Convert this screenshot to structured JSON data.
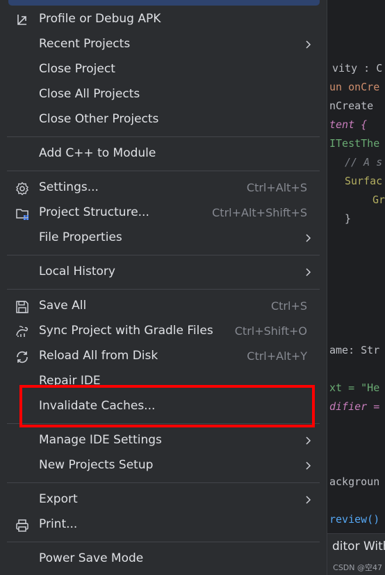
{
  "menu": {
    "items": [
      {
        "label": "Profile or Debug APK",
        "shortcut": "",
        "submenu": false,
        "icon": "profile-debug-icon"
      },
      {
        "label": "Recent Projects",
        "shortcut": "",
        "submenu": true,
        "icon": ""
      },
      {
        "label": "Close Project",
        "shortcut": "",
        "submenu": false,
        "icon": ""
      },
      {
        "label": "Close All Projects",
        "shortcut": "",
        "submenu": false,
        "icon": ""
      },
      {
        "label": "Close Other Projects",
        "shortcut": "",
        "submenu": false,
        "icon": ""
      },
      {
        "label": "Add C++ to Module",
        "shortcut": "",
        "submenu": false,
        "icon": ""
      },
      {
        "label": "Settings...",
        "shortcut": "Ctrl+Alt+S",
        "submenu": false,
        "icon": "gear-icon"
      },
      {
        "label": "Project Structure...",
        "shortcut": "Ctrl+Alt+Shift+S",
        "submenu": false,
        "icon": "project-structure-icon"
      },
      {
        "label": "File Properties",
        "shortcut": "",
        "submenu": true,
        "icon": ""
      },
      {
        "label": "Local History",
        "shortcut": "",
        "submenu": true,
        "icon": ""
      },
      {
        "label": "Save All",
        "shortcut": "Ctrl+S",
        "submenu": false,
        "icon": "save-icon"
      },
      {
        "label": "Sync Project with Gradle Files",
        "shortcut": "Ctrl+Shift+O",
        "submenu": false,
        "icon": "gradle-sync-icon"
      },
      {
        "label": "Reload All from Disk",
        "shortcut": "Ctrl+Alt+Y",
        "submenu": false,
        "icon": "reload-icon"
      },
      {
        "label": "Repair IDE",
        "shortcut": "",
        "submenu": false,
        "icon": ""
      },
      {
        "label": "Invalidate Caches...",
        "shortcut": "",
        "submenu": false,
        "icon": ""
      },
      {
        "label": "Manage IDE Settings",
        "shortcut": "",
        "submenu": true,
        "icon": ""
      },
      {
        "label": "New Projects Setup",
        "shortcut": "",
        "submenu": true,
        "icon": ""
      },
      {
        "label": "Export",
        "shortcut": "",
        "submenu": true,
        "icon": ""
      },
      {
        "label": "Print...",
        "shortcut": "",
        "submenu": false,
        "icon": "printer-icon"
      },
      {
        "label": "Power Save Mode",
        "shortcut": "",
        "submenu": false,
        "icon": ""
      }
    ]
  },
  "editor": {
    "lines": [
      "vity : C",
      "un onCre",
      "nCreate",
      "tent {",
      "ITestThe",
      "// A s",
      "Surfac",
      "Gr",
      "}",
      "ame: Str",
      "xt = \"He",
      "difier =",
      "ackgroun",
      "review()"
    ],
    "bottom_label": "ditor With"
  },
  "watermark": "CSDN @空47",
  "colors": {
    "highlight_border": "#ff0000",
    "menu_bg": "#2b2d30",
    "selected_bg": "#2e436e"
  }
}
